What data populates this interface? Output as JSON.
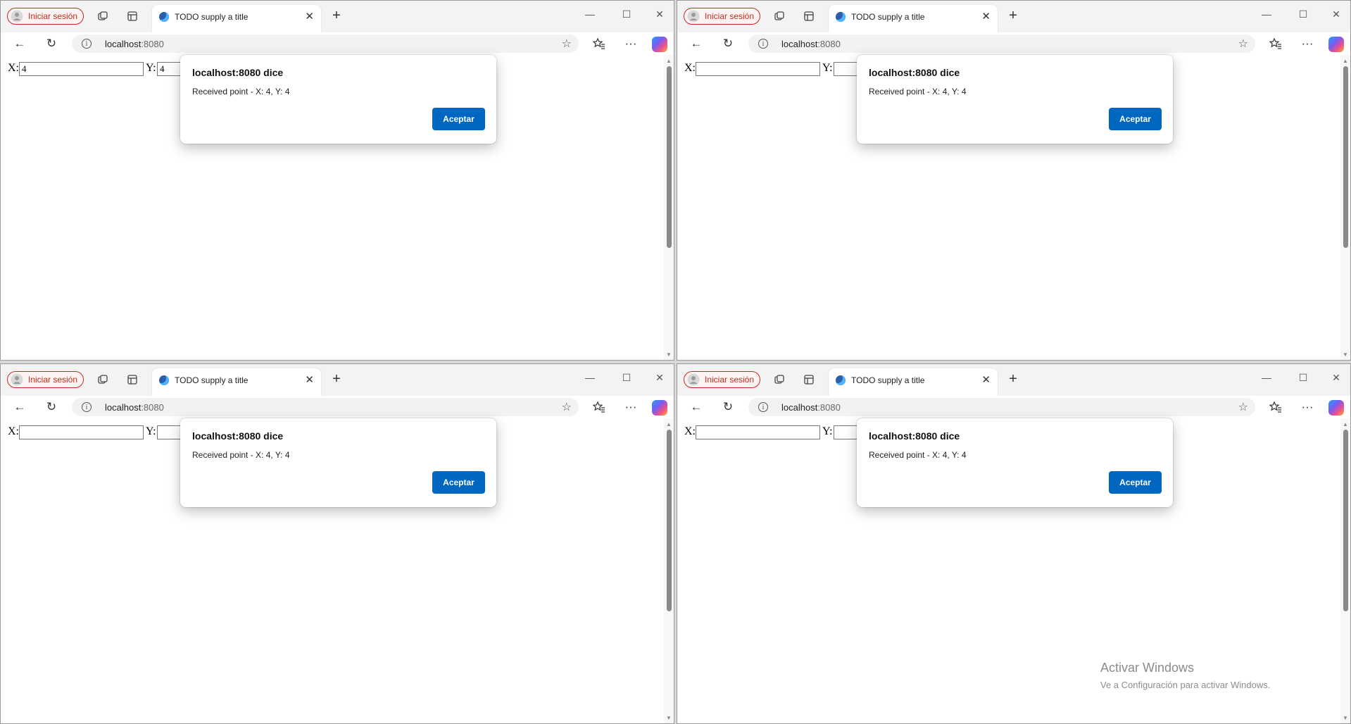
{
  "browser": {
    "signin_label": "Iniciar sesión",
    "tab_title": "TODO supply a title",
    "url_host": "localhost",
    "url_port": ":8080",
    "tab_close_icon": "close-icon",
    "new_tab_icon": "plus-icon"
  },
  "windows": [
    {
      "x_value": "4",
      "y_value": "4"
    },
    {
      "x_value": "",
      "y_value": ""
    },
    {
      "x_value": "",
      "y_value": ""
    },
    {
      "x_value": "",
      "y_value": ""
    }
  ],
  "form": {
    "x_label": "X:",
    "y_label": "Y:"
  },
  "dialog": {
    "title": "localhost:8080 dice",
    "message": "Received point - X: 4, Y: 4",
    "ok_label": "Aceptar"
  },
  "watermark": {
    "line1": "Activar Windows",
    "line2": "Ve a Configuración para activar Windows."
  },
  "colors": {
    "accent": "#0067c0",
    "signin": "#c42b1c"
  }
}
